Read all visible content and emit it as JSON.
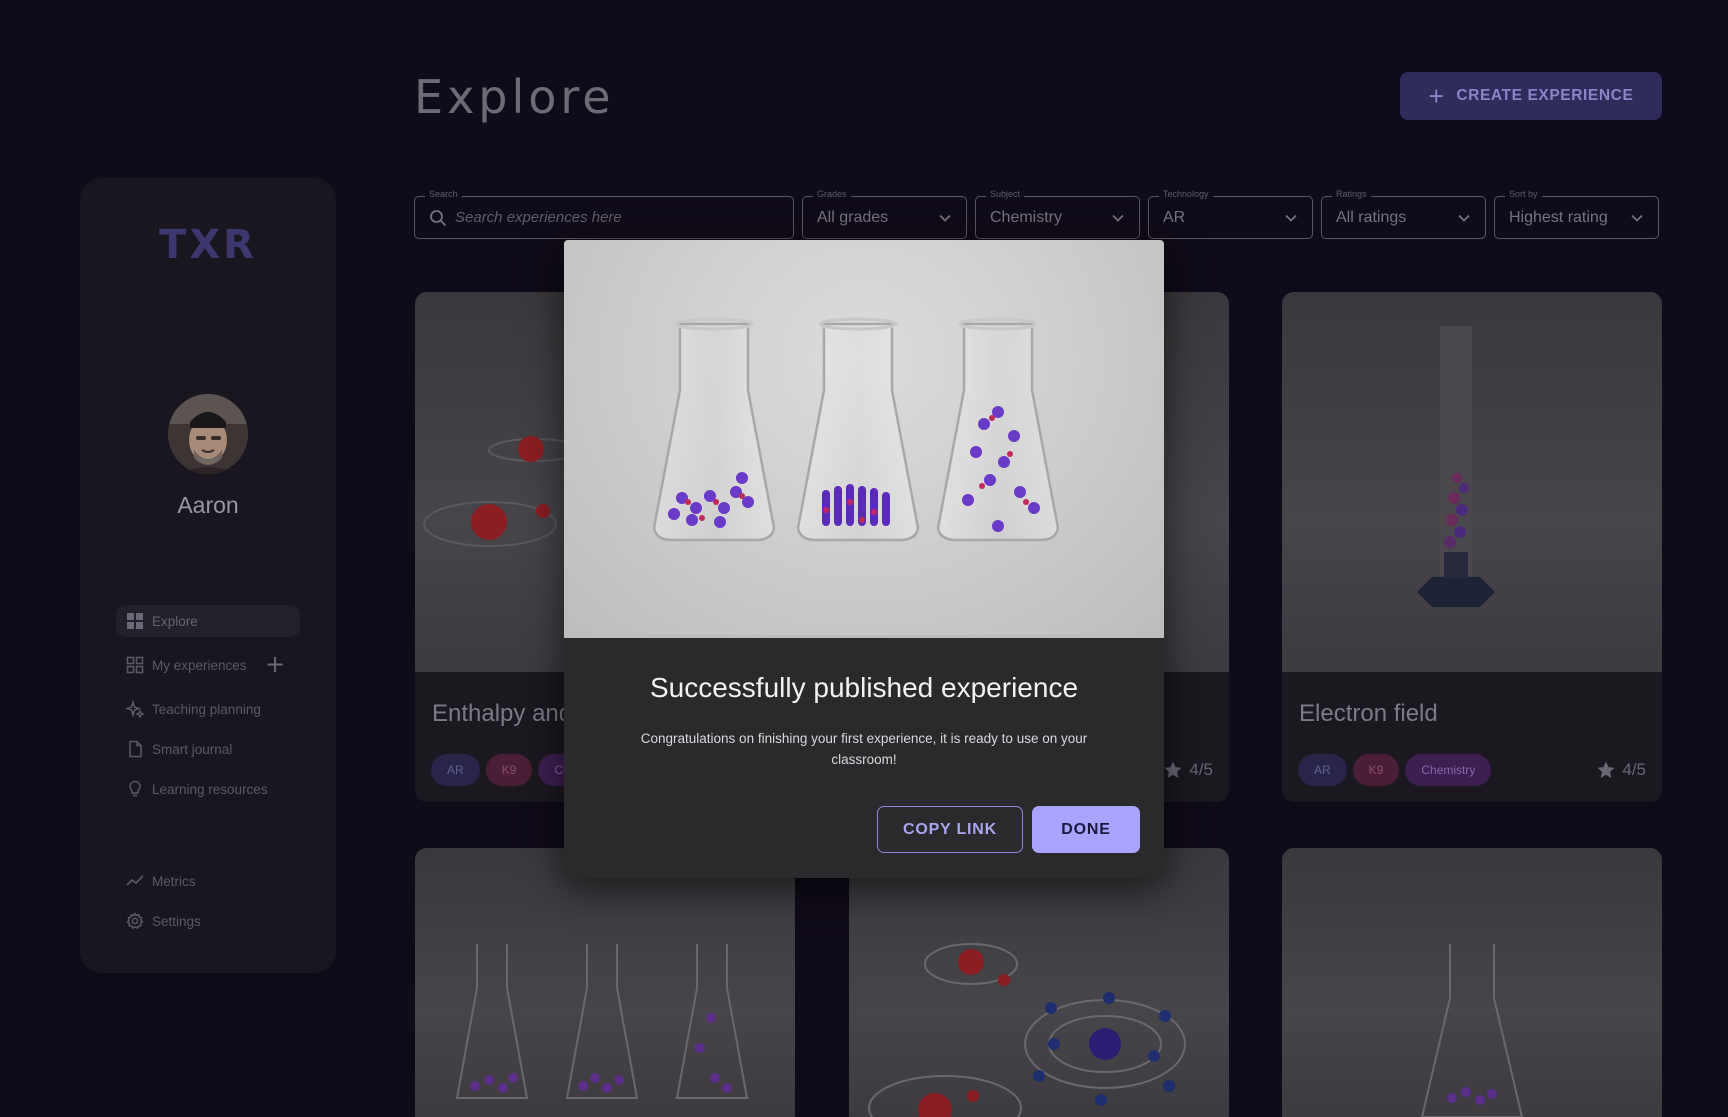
{
  "header": {
    "title": "Explore",
    "create_button": "CREATE EXPERIENCE"
  },
  "sidebar": {
    "logo": "TXR",
    "user_name": "Aaron",
    "items": [
      {
        "label": "Explore",
        "icon": "grid-icon"
      },
      {
        "label": "My experiences",
        "icon": "grid-outline-icon"
      },
      {
        "label": "Teaching planning",
        "icon": "sparkle-icon"
      },
      {
        "label": "Smart journal",
        "icon": "document-icon"
      },
      {
        "label": "Learning resources",
        "icon": "lightbulb-icon"
      },
      {
        "label": "Metrics",
        "icon": "trend-icon"
      },
      {
        "label": "Settings",
        "icon": "gear-icon"
      }
    ]
  },
  "filters": {
    "search": {
      "label": "Search",
      "placeholder": "Search experiences here"
    },
    "grades": {
      "label": "Grades",
      "value": "All grades"
    },
    "subject": {
      "label": "Subject",
      "value": "Chemistry"
    },
    "technology": {
      "label": "Technology",
      "value": "AR"
    },
    "ratings": {
      "label": "Ratings",
      "value": "All ratings"
    },
    "sort": {
      "label": "Sort by",
      "value": "Highest rating"
    }
  },
  "cards": [
    {
      "title": "Enthalpy and",
      "tags": [
        "AR",
        "K9",
        "Ch"
      ],
      "rating": ""
    },
    {
      "title": "",
      "tags": [],
      "rating": "4/5"
    },
    {
      "title": "Electron field",
      "tags": [
        "AR",
        "K9",
        "Chemistry"
      ],
      "rating": "4/5"
    }
  ],
  "modal": {
    "title": "Successfully published experience",
    "message": "Congratulations on finishing your first experience, it is ready to use on your classroom!",
    "copy_button": "COPY LINK",
    "done_button": "DONE"
  },
  "colors": {
    "background": "#100b18",
    "accent": "#a8a4ff",
    "create_button": "#2f2b5a"
  }
}
